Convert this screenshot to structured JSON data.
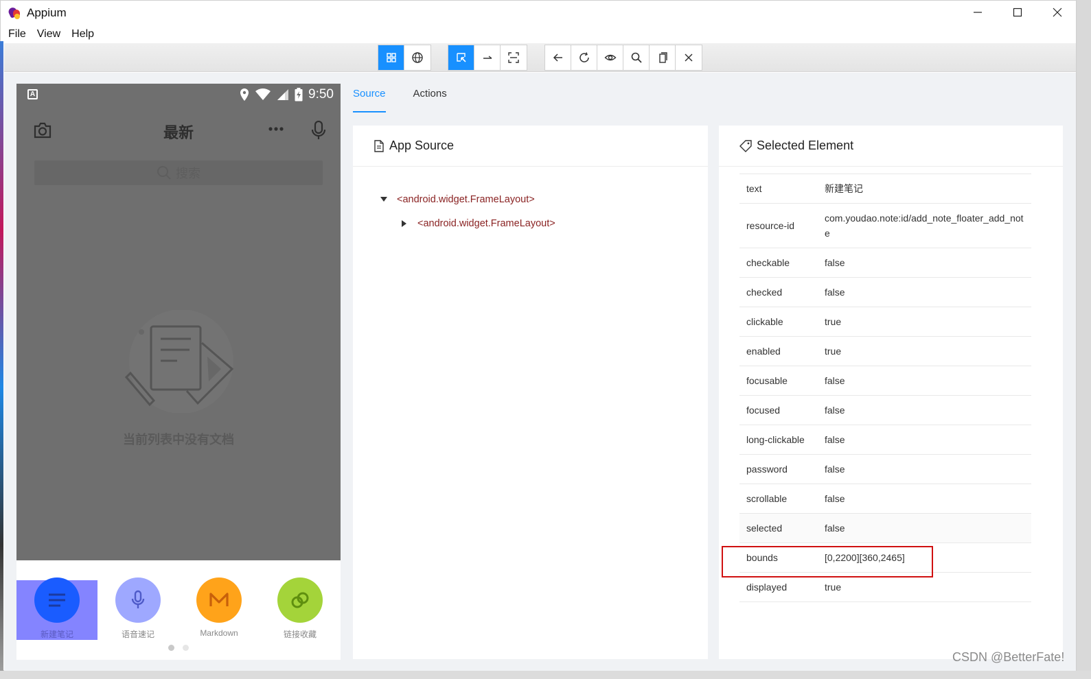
{
  "window": {
    "title": "Appium"
  },
  "menu": [
    "File",
    "View",
    "Help"
  ],
  "device": {
    "status_time": "9:50",
    "header_title": "最新",
    "search_placeholder": "搜索",
    "empty_text": "当前列表中没有文档",
    "actions": [
      {
        "label": "新建笔记",
        "color": "#1a5cff",
        "icon": "note-lines-icon"
      },
      {
        "label": "语音速记",
        "color": "#9ea8ff",
        "icon": "microphone-icon"
      },
      {
        "label": "Markdown",
        "color": "#ffa31a",
        "icon": "markdown-m-icon"
      },
      {
        "label": "链接收藏",
        "color": "#a4d43a",
        "icon": "link-icon"
      }
    ]
  },
  "tabs": [
    "Source",
    "Actions"
  ],
  "source_panel": {
    "title": "App Source",
    "tree": [
      {
        "tag": "<android.widget.FrameLayout>",
        "expanded": true
      },
      {
        "tag": "<android.widget.FrameLayout>",
        "expanded": false
      }
    ]
  },
  "selected_panel": {
    "title": "Selected Element",
    "attributes": [
      {
        "key": "text",
        "value": "新建笔记"
      },
      {
        "key": "resource-id",
        "value": "com.youdao.note:id/add_note_floater_add_note"
      },
      {
        "key": "checkable",
        "value": "false"
      },
      {
        "key": "checked",
        "value": "false"
      },
      {
        "key": "clickable",
        "value": "true"
      },
      {
        "key": "enabled",
        "value": "true"
      },
      {
        "key": "focusable",
        "value": "false"
      },
      {
        "key": "focused",
        "value": "false"
      },
      {
        "key": "long-clickable",
        "value": "false"
      },
      {
        "key": "password",
        "value": "false"
      },
      {
        "key": "scrollable",
        "value": "false"
      },
      {
        "key": "selected",
        "value": "false"
      },
      {
        "key": "bounds",
        "value": "[0,2200][360,2465]"
      },
      {
        "key": "displayed",
        "value": "true"
      }
    ]
  },
  "watermark": "CSDN @BetterFate!",
  "colors": {
    "accent": "#1890ff",
    "highlight": "#d01010",
    "tag_text": "#8a2323"
  }
}
